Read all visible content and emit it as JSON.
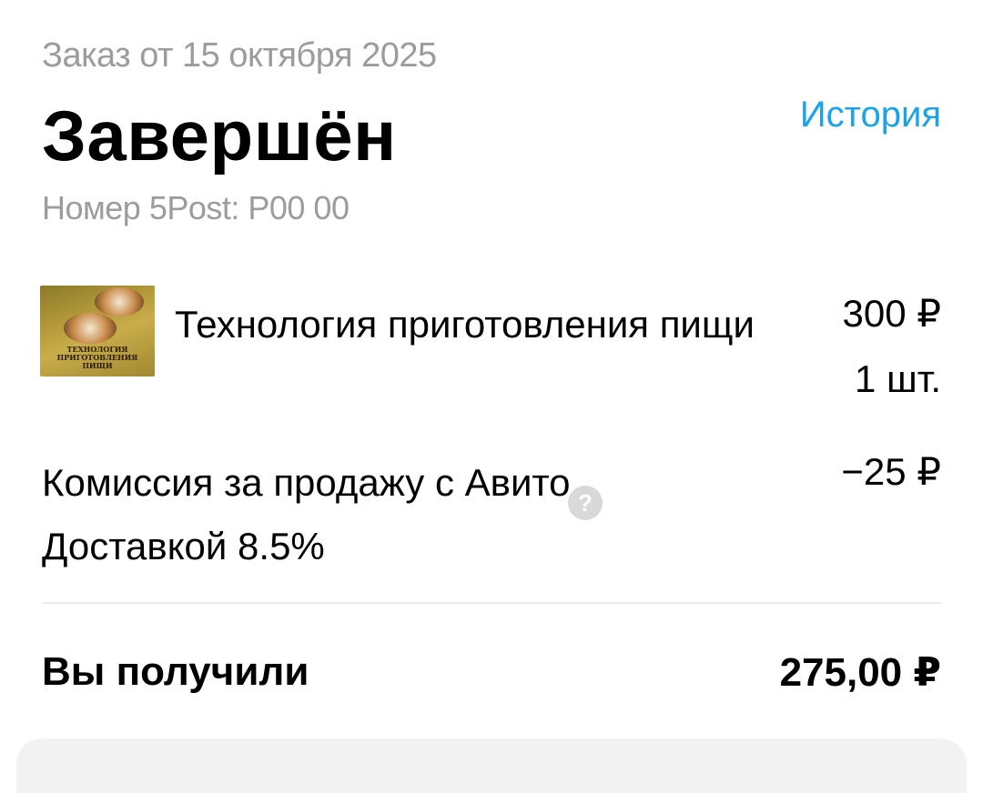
{
  "order": {
    "date_text": "Заказ от 15 октября 2025",
    "status": "Завершён",
    "history_link": "История",
    "tracking_text": "Номер 5Post: P00 00"
  },
  "item": {
    "name": "Технология приготовления пищи",
    "price": "300 ₽",
    "quantity": "1 шт.",
    "cover_text": "ТЕХНОЛОГИЯ ПРИГОТОВЛЕНИЯ ПИЩИ"
  },
  "commission": {
    "label": "Комиссия за продажу с Авито Доставкой 8.5%",
    "amount": "−25 ₽",
    "help_glyph": "?"
  },
  "total": {
    "label": "Вы получили",
    "amount": "275,00 ₽"
  },
  "icons": {
    "help": "question-circle-icon"
  },
  "colors": {
    "link": "#1aa3e8",
    "muted_text": "#9c9c9c",
    "primary_text": "#000000",
    "divider": "#ececec"
  }
}
